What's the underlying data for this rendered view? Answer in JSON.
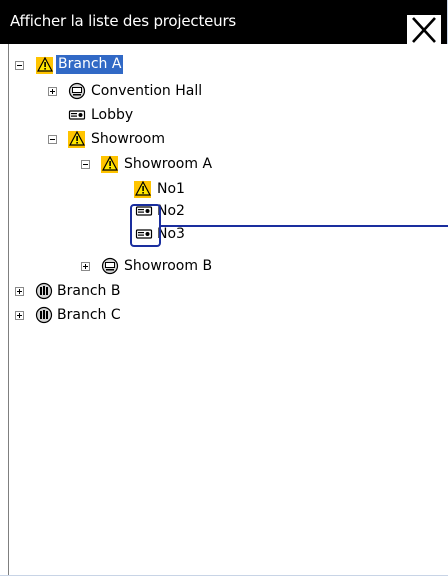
{
  "window": {
    "title": "Afficher la liste des projecteurs",
    "close_icon": "close-x-icon"
  },
  "colors": {
    "titlebar_bg": "#000000",
    "selection_bg": "#3169c6",
    "warning_bg": "#ffc400",
    "callout": "#1a2e9e"
  },
  "tree": {
    "items": [
      {
        "label": "Branch A",
        "level": 0,
        "expander": "minus",
        "icon": "warning-icon",
        "selected": true
      },
      {
        "label": "Convention Hall",
        "level": 1,
        "expander": "plus",
        "icon": "group-icon"
      },
      {
        "label": "Lobby",
        "level": 1,
        "expander": "none",
        "icon": "projector-icon"
      },
      {
        "label": "Showroom",
        "level": 1,
        "expander": "minus",
        "icon": "warning-icon"
      },
      {
        "label": "Showroom A",
        "level": 2,
        "expander": "minus",
        "icon": "warning-icon"
      },
      {
        "label": "No1",
        "level": 3,
        "expander": "none",
        "icon": "warning-icon"
      },
      {
        "label": "No2",
        "level": 3,
        "expander": "none",
        "icon": "projector-icon",
        "highlighted": true
      },
      {
        "label": "No3",
        "level": 3,
        "expander": "none",
        "icon": "projector-icon",
        "highlighted": true
      },
      {
        "label": "Showroom B",
        "level": 2,
        "expander": "plus",
        "icon": "group-icon"
      },
      {
        "label": "Branch B",
        "level": 0,
        "expander": "plus",
        "icon": "building-group-icon"
      },
      {
        "label": "Branch C",
        "level": 0,
        "expander": "plus",
        "icon": "building-group-icon"
      }
    ]
  }
}
